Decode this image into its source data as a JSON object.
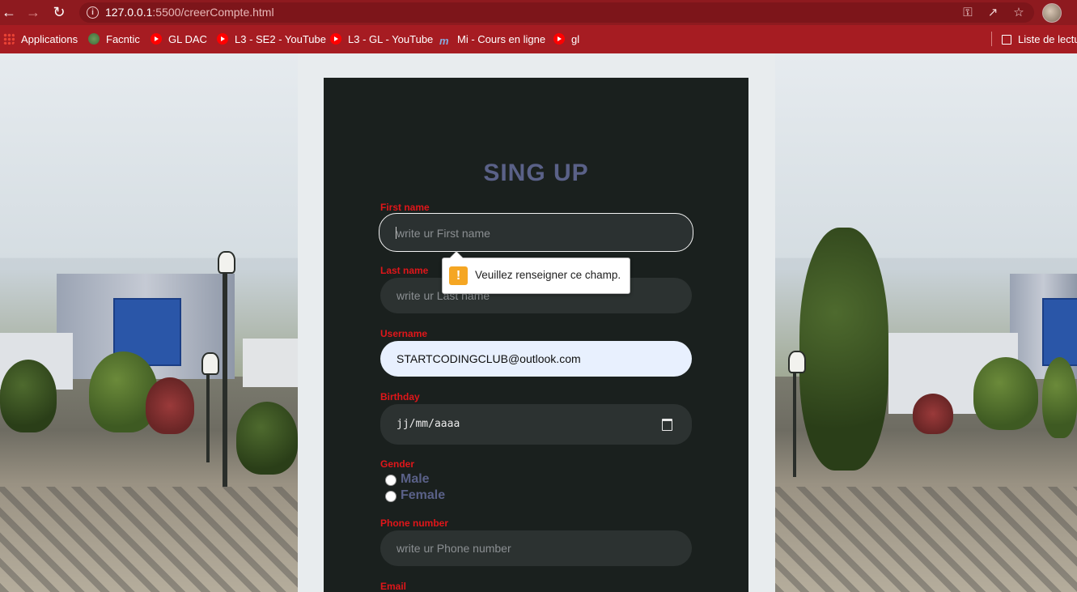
{
  "browser": {
    "url_host": "127.0.0.1",
    "url_path": ":5500/creerCompte.html",
    "bookmarks": [
      {
        "label": "Applications",
        "icon": "apps-grid-icon"
      },
      {
        "label": "Facntic",
        "icon": "facntic-favicon"
      },
      {
        "label": "GL DAC",
        "icon": "youtube-icon"
      },
      {
        "label": "L3 - SE2 - YouTube",
        "icon": "youtube-icon"
      },
      {
        "label": "L3 - GL - YouTube",
        "icon": "youtube-icon"
      },
      {
        "label": "Mi - Cours en ligne",
        "icon": "moodle-icon"
      },
      {
        "label": "gl",
        "icon": "youtube-icon"
      }
    ],
    "reading_list": "Liste de lectu",
    "colors": {
      "titlebar": "#8e1a1f",
      "bookmarks_bar": "#a61c22"
    }
  },
  "form": {
    "title": "SING UP",
    "first_name": {
      "label": "First name",
      "placeholder": "write ur First name"
    },
    "last_name": {
      "label": "Last name",
      "placeholder": "write ur Last name"
    },
    "username": {
      "label": "Username",
      "value": "STARTCODINGCLUB@outlook.com"
    },
    "birthday": {
      "label": "Birthday",
      "value": "jj/mm/aaaa"
    },
    "gender": {
      "label": "Gender",
      "options": [
        "Male",
        "Female"
      ]
    },
    "phone": {
      "label": "Phone number",
      "placeholder": "write ur Phone number"
    },
    "email": {
      "label": "Email"
    },
    "colors": {
      "label": "#e0161a",
      "title": "#5a6188",
      "card": "#0a100e"
    }
  },
  "validation": {
    "message": "Veuillez renseigner ce champ."
  }
}
